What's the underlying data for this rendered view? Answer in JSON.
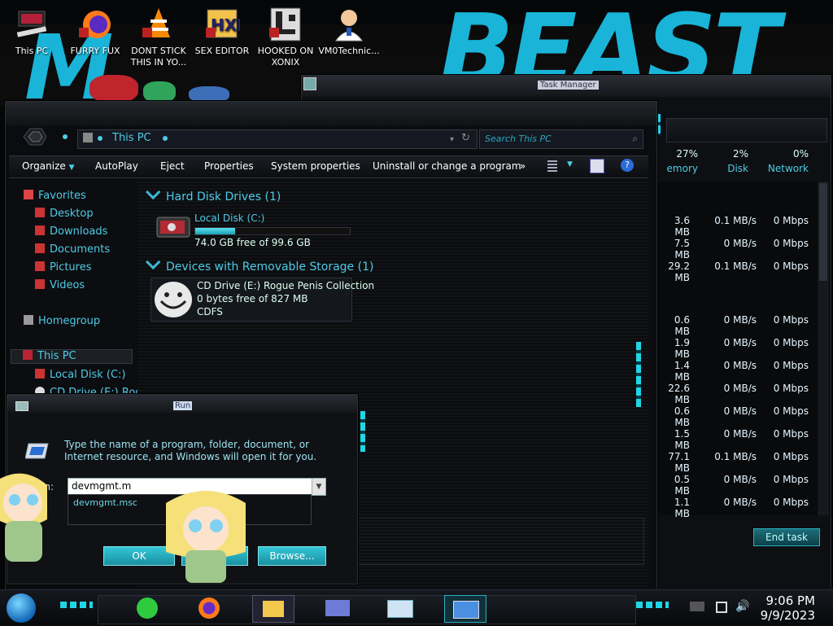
{
  "desktop": {
    "icons": [
      {
        "label": "This PC",
        "icon": "this-pc-icon"
      },
      {
        "label": "FURRY FUX",
        "icon": "firefox-icon"
      },
      {
        "label": "DONT STICK THIS IN YO...",
        "icon": "vlc-icon"
      },
      {
        "label": "SEX EDITOR",
        "icon": "hxd-icon"
      },
      {
        "label": "HOOKED ON XONIX",
        "icon": "xonix-icon"
      },
      {
        "label": "VM0Technic...",
        "icon": "doctor-icon"
      }
    ]
  },
  "taskmgr": {
    "title": "Task Manager",
    "headers": [
      {
        "pct": "27%",
        "name": "emory"
      },
      {
        "pct": "2%",
        "name": "Disk"
      },
      {
        "pct": "0%",
        "name": "Network"
      }
    ],
    "rows": [
      {
        "mem": "3.6 MB",
        "disk": "0.1 MB/s",
        "net": "0 Mbps"
      },
      {
        "mem": "7.5 MB",
        "disk": "0 MB/s",
        "net": "0 Mbps"
      },
      {
        "mem": "29.2 MB",
        "disk": "0.1 MB/s",
        "net": "0 Mbps"
      },
      {
        "mem": "0.6 MB",
        "disk": "0 MB/s",
        "net": "0 Mbps"
      },
      {
        "mem": "1.9 MB",
        "disk": "0 MB/s",
        "net": "0 Mbps"
      },
      {
        "mem": "1.4 MB",
        "disk": "0 MB/s",
        "net": "0 Mbps"
      },
      {
        "mem": "22.6 MB",
        "disk": "0 MB/s",
        "net": "0 Mbps"
      },
      {
        "mem": "0.6 MB",
        "disk": "0 MB/s",
        "net": "0 Mbps"
      },
      {
        "mem": "1.5 MB",
        "disk": "0 MB/s",
        "net": "0 Mbps"
      },
      {
        "mem": "77.1 MB",
        "disk": "0.1 MB/s",
        "net": "0 Mbps"
      },
      {
        "mem": "0.5 MB",
        "disk": "0 MB/s",
        "net": "0 Mbps"
      },
      {
        "mem": "1.1 MB",
        "disk": "0 MB/s",
        "net": "0 Mbps"
      }
    ],
    "end_task": "End task"
  },
  "explorer": {
    "address": "This PC",
    "search_placeholder": "Search This PC",
    "toolbar": [
      "Organize",
      "AutoPlay",
      "Eject",
      "Properties",
      "System properties",
      "Uninstall or change a program",
      "»"
    ],
    "nav": {
      "favorites": "Favorites",
      "fav_items": [
        "Desktop",
        "Downloads",
        "Documents",
        "Pictures",
        "Videos"
      ],
      "homegroup": "Homegroup",
      "this_pc": "This PC",
      "pc_items": [
        "Local Disk (C:)",
        "CD Drive (E:) Rogue"
      ]
    },
    "groups": {
      "hdd": "Hard Disk Drives (1)",
      "removable": "Devices with Removable Storage (1)"
    },
    "local_disk": {
      "name": "Local Disk (C:)",
      "free": "74.0 GB free of 99.6 GB",
      "used_fraction": 0.26
    },
    "cd_drive": {
      "name": "CD Drive (E:) Rogue Penis Collection",
      "free": "0 bytes free of 827 MB",
      "fs": "CDFS"
    }
  },
  "run": {
    "title": "Run",
    "description": "Type the name of a program, folder, document, or Internet resource, and Windows will open it for you.",
    "open_label": "en:",
    "input_value": "devmgmt.m",
    "suggestion": "devmgmt.msc",
    "ok": "OK",
    "browse": "Browse..."
  },
  "taskbar": {
    "time": "9:06 PM",
    "date": "9/9/2023"
  },
  "colors": {
    "accent": "#4ecbe6",
    "cyan": "#1fd6e6"
  }
}
